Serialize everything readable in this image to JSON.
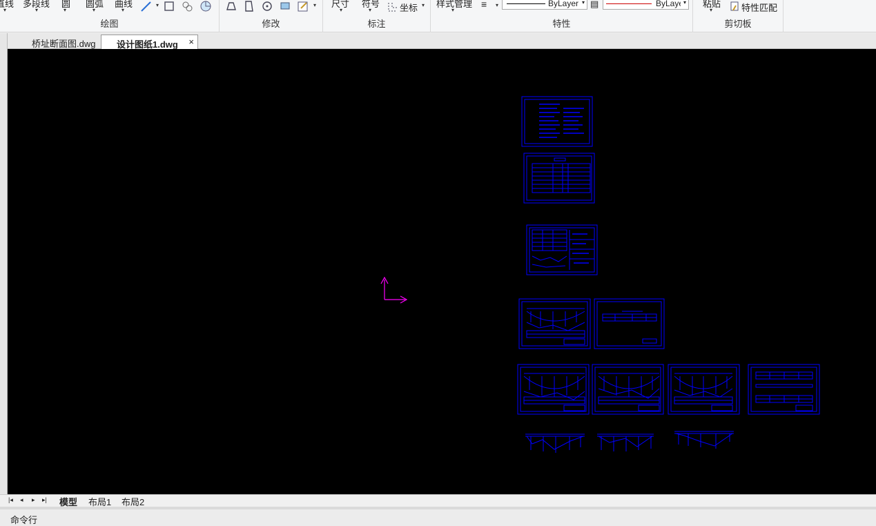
{
  "ribbon": {
    "draw_group": {
      "label": "绘图",
      "btn_line": "直线",
      "btn_polyline": "多段线",
      "btn_circle": "圆",
      "btn_arc": "圆弧",
      "btn_curve": "曲线"
    },
    "modify_group": {
      "label": "修改"
    },
    "annotate_group": {
      "label": "标注",
      "btn_dimension": "尺寸",
      "btn_symbol": "符号",
      "btn_coord": "坐标"
    },
    "props_group": {
      "label": "特性",
      "btn_style_mgr": "样式管理",
      "linetype_value": "ByLayer",
      "lineweight_value": "ByLayer",
      "linetype_color": "#000000",
      "lineweight_color": "#cc0000"
    },
    "clipboard_group": {
      "label": "剪切板",
      "btn_paste": "粘贴",
      "btn_match": "特性匹配"
    }
  },
  "doc_tabs": [
    {
      "label": "桥址断面图.dwg",
      "active": false
    },
    {
      "label": "设计图纸1.dwg",
      "active": true
    }
  ],
  "layout_tabs": [
    {
      "label": "模型",
      "active": true
    },
    {
      "label": "布局1",
      "active": false
    },
    {
      "label": "布局2",
      "active": false
    }
  ],
  "command_line": {
    "label": "命令行"
  },
  "colors": {
    "canvas_bg": "#000000",
    "sheet_line": "#0000ff",
    "ucs": "#ff00ff"
  }
}
